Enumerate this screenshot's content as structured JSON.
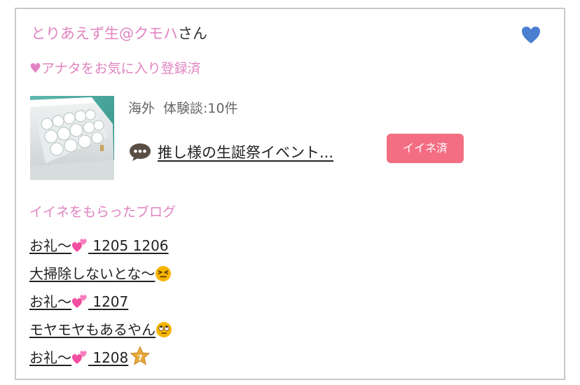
{
  "user": {
    "name": "とりあえず生@クモハ",
    "honorific": "さん",
    "favorite_status": "♥アナタをお気に入り登録済"
  },
  "review": {
    "region": "海外",
    "experience_count": "体験談:10件",
    "blog_title": "推し様の生誕祭イベント...",
    "badge": "イイネ済"
  },
  "liked_blogs": {
    "title": "イイネをもらったブログ",
    "posts": [
      {
        "before": "お礼～",
        "icon": "two-hearts-icon",
        "after": " 1205 1206"
      },
      {
        "before": "大掃除しないとな～",
        "icon": "persevering-face-icon",
        "after": ""
      },
      {
        "before": "お礼～",
        "icon": "two-hearts-icon",
        "after": " 1207"
      },
      {
        "before": "モヤモヤもあるやん",
        "icon": "rolling-eyes-face-icon",
        "after": ""
      },
      {
        "before": "お礼～",
        "icon": "two-hearts-icon",
        "after": " 1208",
        "badge_icon": "star-7-badge-icon"
      }
    ]
  },
  "colors": {
    "pink_text": "#e183c0",
    "heart_blue": "#4a7fd0",
    "badge_red": "#f36e83",
    "border": "#c9c9c9"
  }
}
